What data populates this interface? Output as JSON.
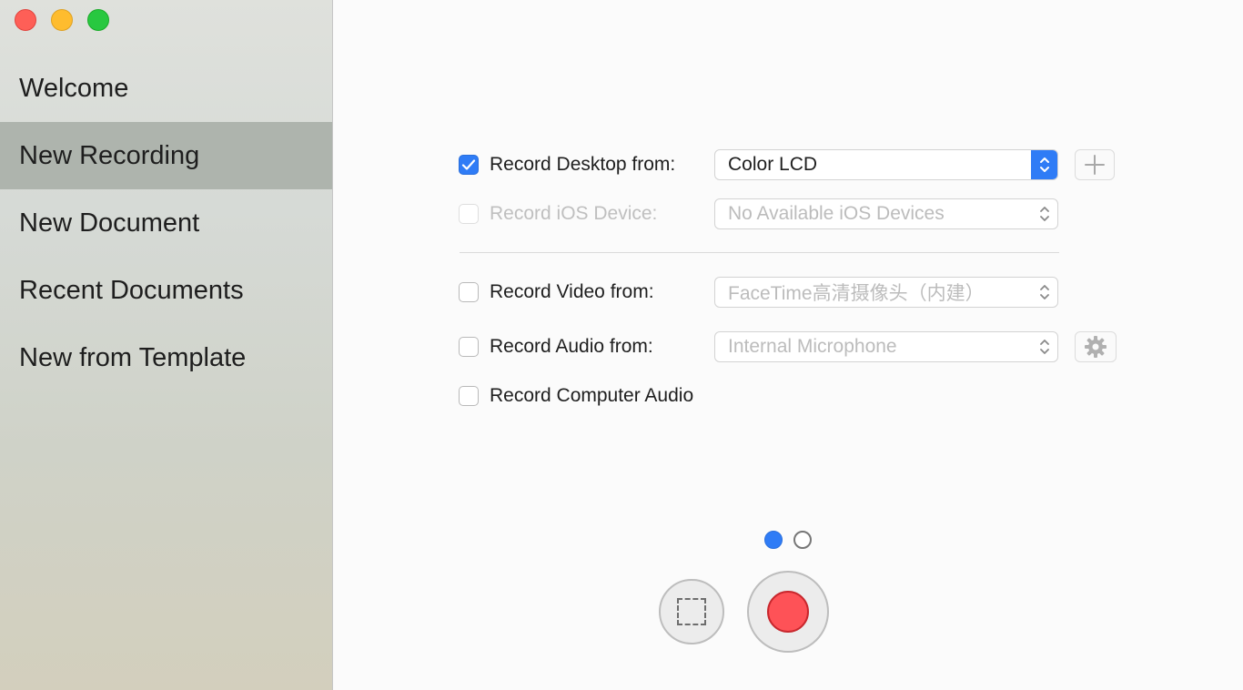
{
  "sidebar": {
    "items": [
      {
        "label": "Welcome",
        "active": false
      },
      {
        "label": "New Recording",
        "active": true
      },
      {
        "label": "New Document",
        "active": false
      },
      {
        "label": "Recent Documents",
        "active": false
      },
      {
        "label": "New from Template",
        "active": false
      }
    ]
  },
  "options": {
    "desktop": {
      "label": "Record Desktop from:",
      "checked": true,
      "value": "Color LCD"
    },
    "ios": {
      "label": "Record iOS Device:",
      "checked": false,
      "enabled": false,
      "value": "No Available iOS Devices"
    },
    "video": {
      "label": "Record Video from:",
      "checked": false,
      "value": "FaceTime高清摄像头（内建）"
    },
    "audio": {
      "label": "Record Audio from:",
      "checked": false,
      "value": "Internal Microphone"
    },
    "computer_audio": {
      "label": "Record Computer Audio",
      "checked": false
    }
  },
  "pager": {
    "current": 1,
    "total": 2
  },
  "colors": {
    "accent": "#2f7cf6",
    "record": "#fe5257",
    "sidebar_active": "#aeb4ad"
  },
  "icons": {
    "add": "plus-icon",
    "settings": "gear-icon",
    "region": "dashed-rectangle-icon",
    "record": "record-dot-icon"
  }
}
